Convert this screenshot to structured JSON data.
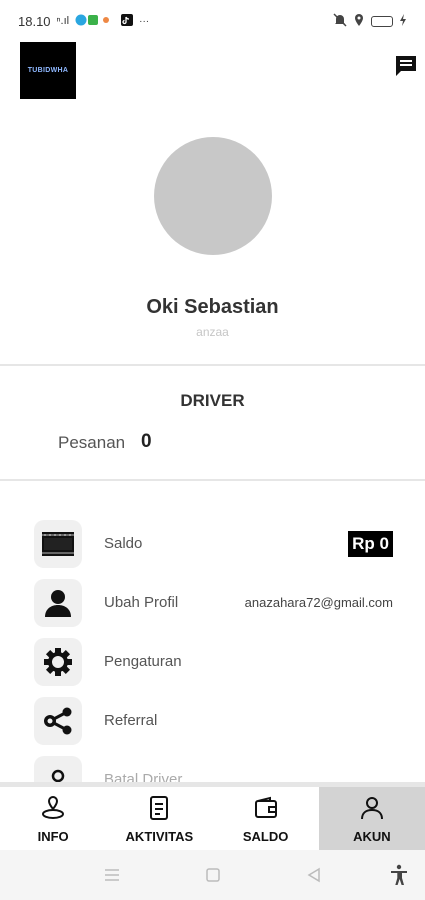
{
  "status_bar": {
    "time": "18.10",
    "signal_text": "ⁿ.ıl",
    "more": "···"
  },
  "header": {
    "logo_text": "TUBIDWHA",
    "chat_icon": "chat-icon"
  },
  "profile": {
    "name": "Oki Sebastian",
    "username": "anzaa"
  },
  "role": {
    "title": "DRIVER",
    "pesanan_label": "Pesanan",
    "pesanan_value": "0"
  },
  "menu": {
    "saldo": {
      "label": "Saldo",
      "value": "Rp 0",
      "icon": "wallet-icon"
    },
    "ubah_profil": {
      "label": "Ubah Profil",
      "value": "anazahara72@gmail.com",
      "icon": "user-icon"
    },
    "pengaturan": {
      "label": "Pengaturan",
      "icon": "gear-icon"
    },
    "referral": {
      "label": "Referral",
      "icon": "share-icon"
    },
    "partial": {
      "label": "Batal Driver",
      "icon": "pin-icon"
    }
  },
  "bottom_nav": {
    "info": "INFO",
    "aktivitas": "AKTIVITAS",
    "saldo": "SALDO",
    "akun": "AKUN",
    "active": "akun"
  },
  "colors": {
    "active_tab_bg": "#d3d3d3",
    "avatar_bg": "#c8c8c8",
    "icon_tile_bg": "#f0f0f0"
  }
}
